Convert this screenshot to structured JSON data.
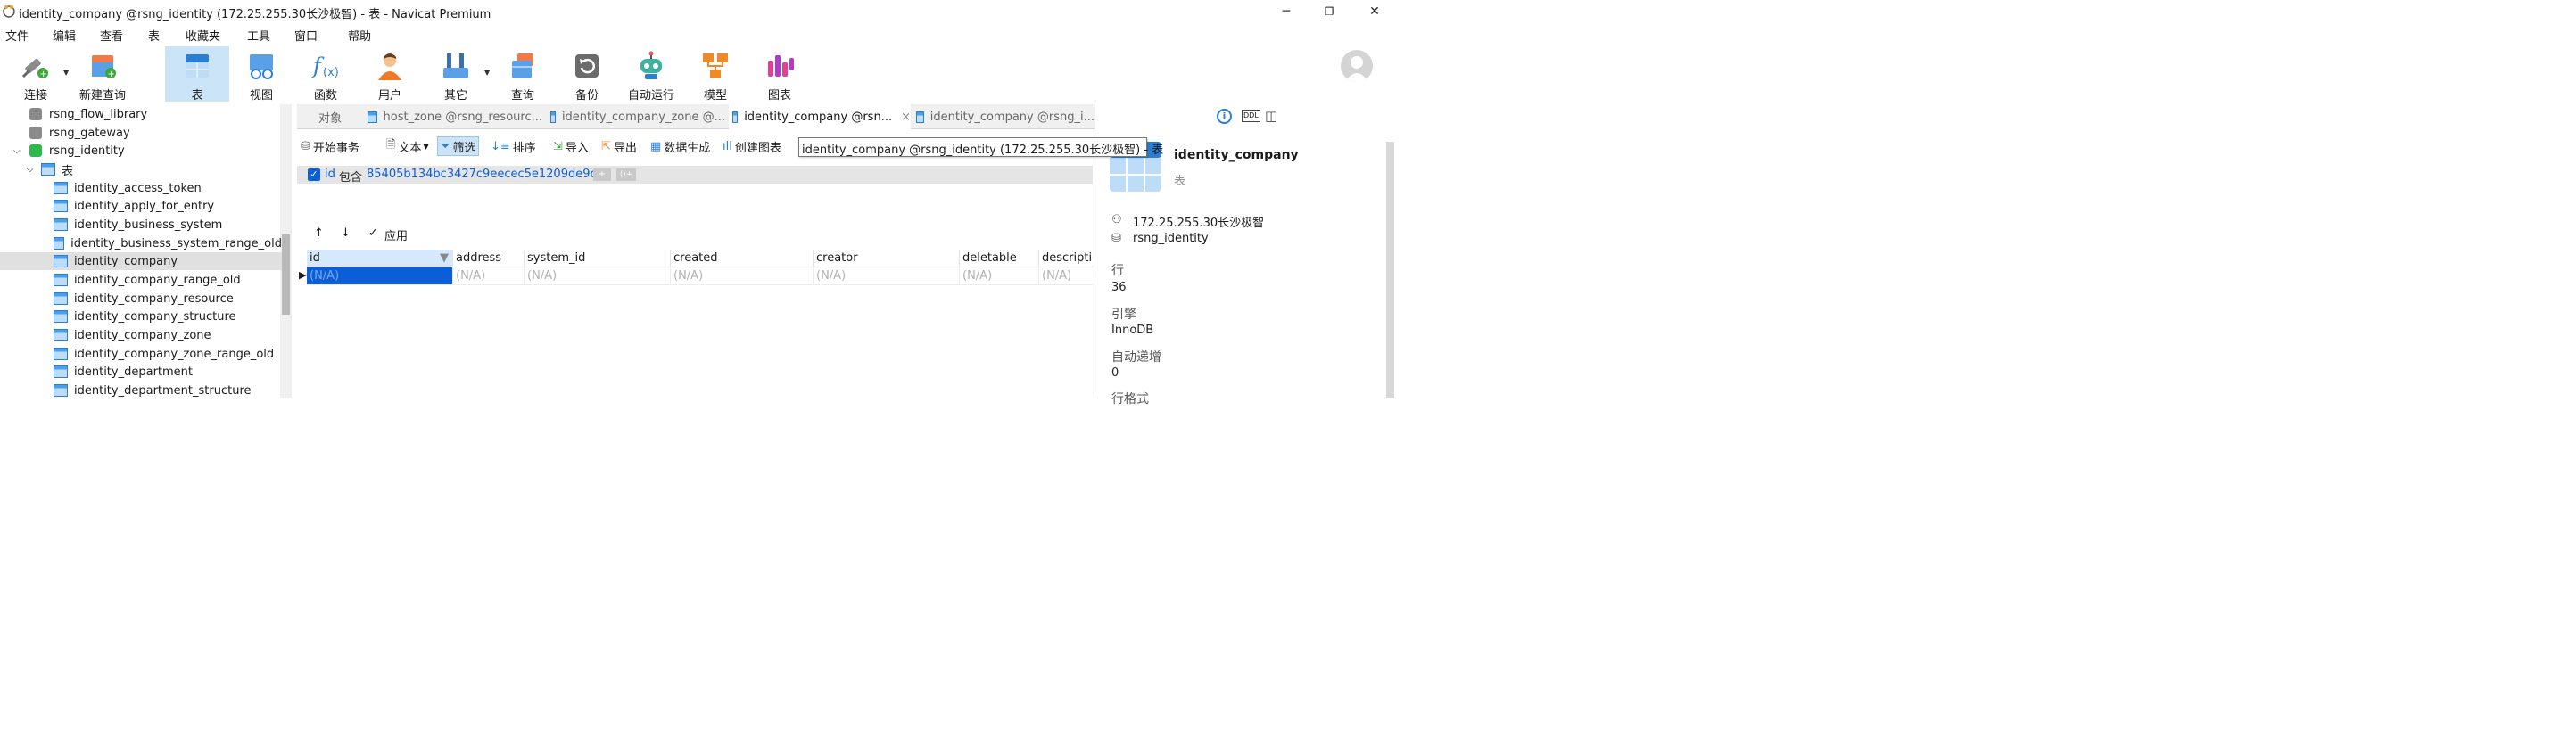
{
  "window": {
    "title": "identity_company @rsng_identity (172.25.255.30长沙极智) - 表 - Navicat Premium",
    "minimize": "─",
    "restore": "❐",
    "close": "✕"
  },
  "menu": [
    "文件",
    "编辑",
    "查看",
    "表",
    "收藏夹",
    "工具",
    "窗口",
    "帮助"
  ],
  "toolbar": {
    "connect": "连接",
    "new_query": "新建查询",
    "table": "表",
    "view": "视图",
    "function": "函数",
    "user": "用户",
    "other": "其它",
    "query": "查询",
    "backup": "备份",
    "automation": "自动运行",
    "model": "模型",
    "chart": "图表"
  },
  "tree": {
    "items": [
      {
        "label": "rsng_flow_library"
      },
      {
        "label": "rsng_gateway"
      },
      {
        "label": "rsng_identity"
      },
      {
        "label": "表"
      },
      {
        "label": "identity_access_token"
      },
      {
        "label": "identity_apply_for_entry"
      },
      {
        "label": "identity_business_system"
      },
      {
        "label": "identity_business_system_range_old"
      },
      {
        "label": "identity_company"
      },
      {
        "label": "identity_company_range_old"
      },
      {
        "label": "identity_company_resource"
      },
      {
        "label": "identity_company_structure"
      },
      {
        "label": "identity_company_zone"
      },
      {
        "label": "identity_company_zone_range_old"
      },
      {
        "label": "identity_department"
      },
      {
        "label": "identity_department_structure"
      }
    ]
  },
  "tabs": {
    "objects": "对象",
    "t1": "host_zone @rsng_resourc...",
    "t2": "identity_company_zone @...",
    "t3": "identity_company @rsn...",
    "t3_close": "×",
    "t4": "identity_company @rsng_i..."
  },
  "subtoolbar": {
    "begin_tx": "开始事务",
    "text": "文本",
    "filter": "筛选",
    "sort": "排序",
    "import": "导入",
    "export": "导出",
    "datagen": "数据生成",
    "create_chart": "创建图表"
  },
  "tooltip": "identity_company @rsng_identity (172.25.255.30长沙极智) - 表",
  "filter": {
    "field": "id",
    "op": "包含",
    "value": "85405b134bc3427c9eecec5e1209de9d",
    "add": "+",
    "add_group": "⟨⟩+"
  },
  "applybar": {
    "up": "↑",
    "down": "↓",
    "apply": "应用"
  },
  "grid": {
    "columns": [
      "id",
      "address",
      "system_id",
      "created",
      "creator",
      "deletable",
      "descriptio"
    ],
    "row": [
      "(N/A)",
      "(N/A)",
      "(N/A)",
      "(N/A)",
      "(N/A)",
      "(N/A)",
      "(N/A)"
    ]
  },
  "panel": {
    "name": "identity_company",
    "type": "表",
    "server": "172.25.255.30长沙极智",
    "database": "rsng_identity",
    "rows_label": "行",
    "rows": "36",
    "engine_label": "引擎",
    "engine": "InnoDB",
    "autoinc_label": "自动递增",
    "autoinc": "0",
    "rowformat_label": "行格式"
  },
  "colors": {
    "accent": "#0a5ed7",
    "selected_tab": "#cce4f7"
  }
}
